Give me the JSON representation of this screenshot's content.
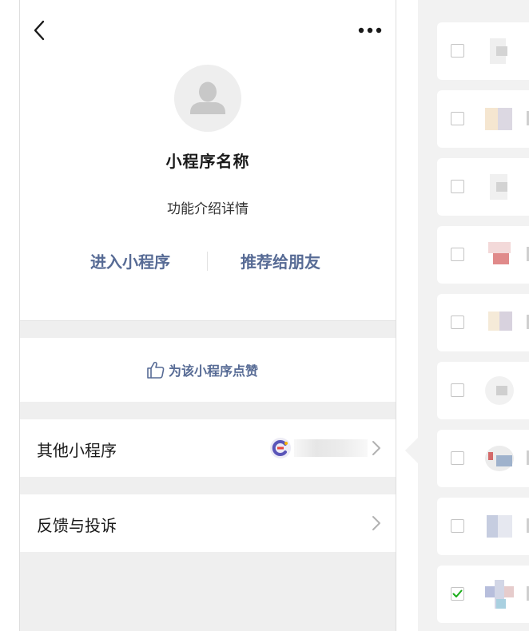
{
  "profile": {
    "back_icon": "chevron-left-icon",
    "more_icon": "more-dots-icon",
    "avatar_icon": "user-placeholder-icon",
    "app_name": "小程序名称",
    "description": "功能介绍详情",
    "enter_label": "进入小程序",
    "recommend_label": "推荐给朋友"
  },
  "like": {
    "icon": "thumbs-up-icon",
    "label": "为该小程序点赞"
  },
  "menu": {
    "other_label": "其他小程序",
    "feedback_label": "反馈与投诉"
  },
  "colors": {
    "accent": "#576b95",
    "check": "#1aad19",
    "background": "#efefef"
  },
  "list": {
    "checked": [
      false,
      false,
      false,
      false,
      false,
      false,
      false,
      false,
      true
    ]
  }
}
